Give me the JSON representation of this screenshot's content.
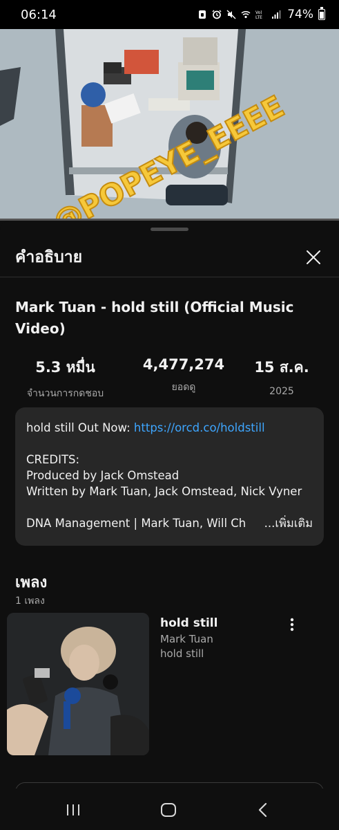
{
  "status_bar": {
    "time": "06:14",
    "battery": "74%",
    "icons": [
      "talkback-icon",
      "alarm-icon",
      "mute-icon",
      "wifi-icon",
      "volte-icon",
      "signal-icon",
      "battery-icon"
    ],
    "battery_level_fraction": 0.74
  },
  "video": {
    "watermark": "@POPEYE_EEEE",
    "progress_fraction": 0.0
  },
  "sheet": {
    "title": "คำอธิบาย",
    "close_icon": "close-icon"
  },
  "video_info": {
    "title": "Mark Tuan - hold still (Official Music Video)",
    "stats": [
      {
        "value": "5.3 หมื่น",
        "label": "จำนวนการกดชอบ"
      },
      {
        "value": "4,477,274",
        "label": "ยอดดู"
      },
      {
        "value": "15 ส.ค.",
        "label": "2025"
      }
    ]
  },
  "description": {
    "line1_text": "hold still Out Now: ",
    "line1_link": "https://orcd.co/holdstill",
    "credits_heading": "CREDITS:",
    "produced_by": "Produced by Jack Omstead",
    "written_by": "Written by Mark Tuan, Jack Omstead, Nick Vyner",
    "management": "DNA Management | Mark Tuan, Will Ch",
    "more_label": "...เพิ่มเติม"
  },
  "music": {
    "heading": "เพลง",
    "count": "1 เพลง",
    "songs": [
      {
        "title": "hold still",
        "artist": "Mark Tuan",
        "album": "hold still",
        "menu_icon": "more-vert-icon"
      }
    ]
  },
  "nav_bar": {
    "icons": [
      "recent-apps-icon",
      "home-icon",
      "back-icon"
    ]
  },
  "colors": {
    "background": "#0f0f0f",
    "card": "#272727",
    "link": "#3ea6ff",
    "secondary_text": "#aaaaaa",
    "watermark": "#f6c83a"
  }
}
